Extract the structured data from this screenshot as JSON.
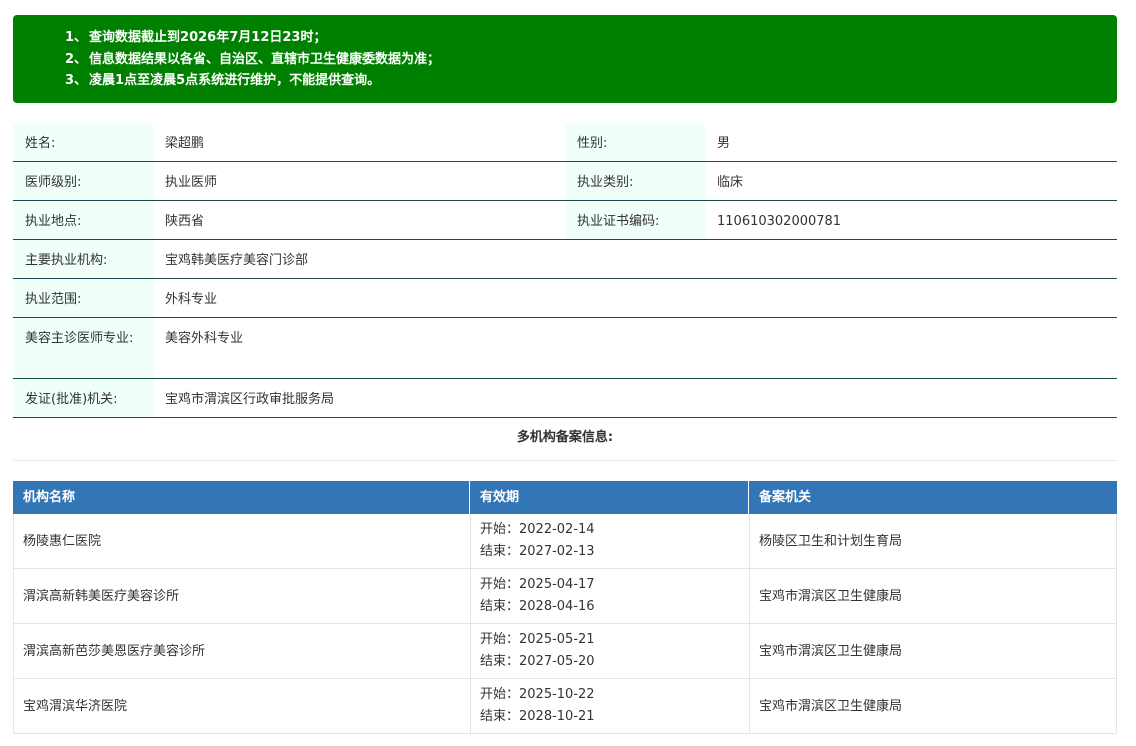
{
  "notice": {
    "lines": [
      {
        "num": "1、",
        "text": "查询数据截止到2026年7月12日23时；"
      },
      {
        "num": "2、",
        "text": "信息数据结果以各省、自治区、直辖市卫生健康委数据为准；"
      },
      {
        "num": "3、",
        "text": "凌晨1点至凌晨5点系统进行维护，不能提供查询。"
      }
    ]
  },
  "doctor": {
    "name_label": "姓名:",
    "name": "梁超鹏",
    "gender_label": "性别:",
    "gender": "男",
    "level_label": "医师级别:",
    "level": "执业医师",
    "category_label": "执业类别:",
    "category": "临床",
    "location_label": "执业地点:",
    "location": "陕西省",
    "cert_label": "执业证书编码:",
    "cert": "110610302000781",
    "institution_label": "主要执业机构:",
    "institution": "宝鸡韩美医疗美容门诊部",
    "scope_label": "执业范围:",
    "scope": "外科专业",
    "beauty_label": "美容主诊医师专业:",
    "beauty": "美容外科专业",
    "issuer_label": "发证(批准)机关:",
    "issuer": "宝鸡市渭滨区行政审批服务局"
  },
  "multi": {
    "title": "多机构备案信息:",
    "headers": [
      "机构名称",
      "有效期",
      "备案机关"
    ],
    "rows": [
      {
        "name": "杨陵惠仁医院",
        "start": "开始：2022-02-14",
        "end": "结束：2027-02-13",
        "authority": "杨陵区卫生和计划生育局"
      },
      {
        "name": "渭滨高新韩美医疗美容诊所",
        "start": "开始：2025-04-17",
        "end": "结束：2028-04-16",
        "authority": "宝鸡市渭滨区卫生健康局"
      },
      {
        "name": "渭滨高新芭莎美恩医疗美容诊所",
        "start": "开始：2025-05-21",
        "end": "结束：2027-05-20",
        "authority": "宝鸡市渭滨区卫生健康局"
      },
      {
        "name": "宝鸡渭滨华济医院",
        "start": "开始：2025-10-22",
        "end": "结束：2028-10-21",
        "authority": "宝鸡市渭滨区卫生健康局"
      }
    ]
  }
}
